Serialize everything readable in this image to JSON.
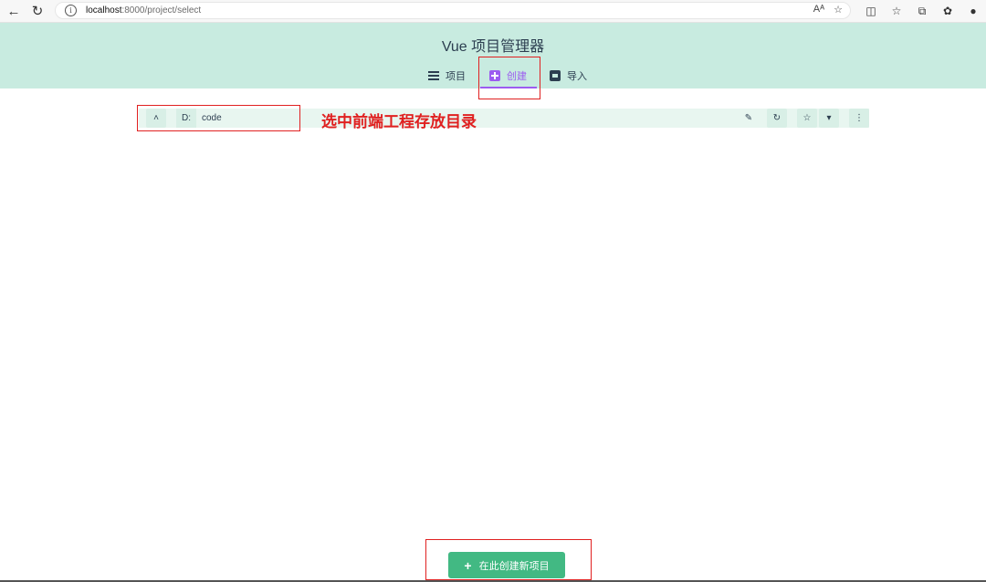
{
  "browser": {
    "url_host": "localhost",
    "url_path": ":8000/project/select",
    "read_aloud": "Aᴬ",
    "favorite": "☆"
  },
  "app": {
    "title": "Vue 项目管理器"
  },
  "nav": {
    "items": [
      {
        "label": "项目",
        "icon": "list-icon"
      },
      {
        "label": "创建",
        "icon": "plus-square-icon",
        "active": true
      },
      {
        "label": "导入",
        "icon": "archive-icon"
      }
    ]
  },
  "folder_bar": {
    "drive": "D:",
    "folder": "code"
  },
  "annotation": {
    "text": "选中前端工程存放目录"
  },
  "actions": {
    "create_here": "在此创建新项目"
  },
  "colors": {
    "accent_green": "#42b983",
    "header_bg": "#c8ebe0",
    "active_purple": "#9c5cf0",
    "annotation_red": "#e02020"
  }
}
